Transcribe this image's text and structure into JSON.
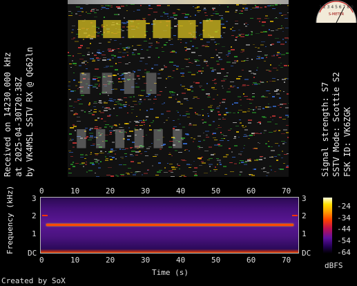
{
  "left_caption": {
    "line1": "Received on  14230.000 kHz",
    "line2": "at 2025-04-30T20:38Z",
    "line3": "by VK4MSL SSTV RX @ QG62ln"
  },
  "right_caption": {
    "line1": "Signal strength: S7",
    "line2": "SSTV Mode: Scottie S2",
    "line3": "FSK ID: VK6ZGK"
  },
  "spectrogram": {
    "x_axis_label": "Time (s)",
    "y_axis_label": "Frequency (kHz)",
    "x_ticks": [
      "0",
      "10",
      "20",
      "30",
      "40",
      "50",
      "60",
      "70"
    ],
    "y_ticks_left": [
      "3",
      "2",
      "1",
      "DC"
    ],
    "y_ticks_right": [
      "3",
      "2",
      "1",
      "DC"
    ],
    "colorbar_ticks": [
      "-24",
      "-34",
      "-44",
      "-54",
      "-64"
    ],
    "colorbar_unit": "dBFS",
    "colormap": [
      "#000000",
      "#200050",
      "#6010a0",
      "#c01050",
      "#ff4000",
      "#ffa000",
      "#ffe000",
      "#ffffe0"
    ]
  },
  "footer": {
    "credit": "Created by SoX"
  },
  "meter": {
    "scale_numbers": "1 2 3 4 5 6 7 8 9",
    "label": "S-METER",
    "needle_level": 0.65
  },
  "sstv_image": {
    "accent_colors": [
      "#ffd000",
      "#30c030",
      "#ff4040",
      "#4080ff",
      "#d0d0d0"
    ]
  }
}
